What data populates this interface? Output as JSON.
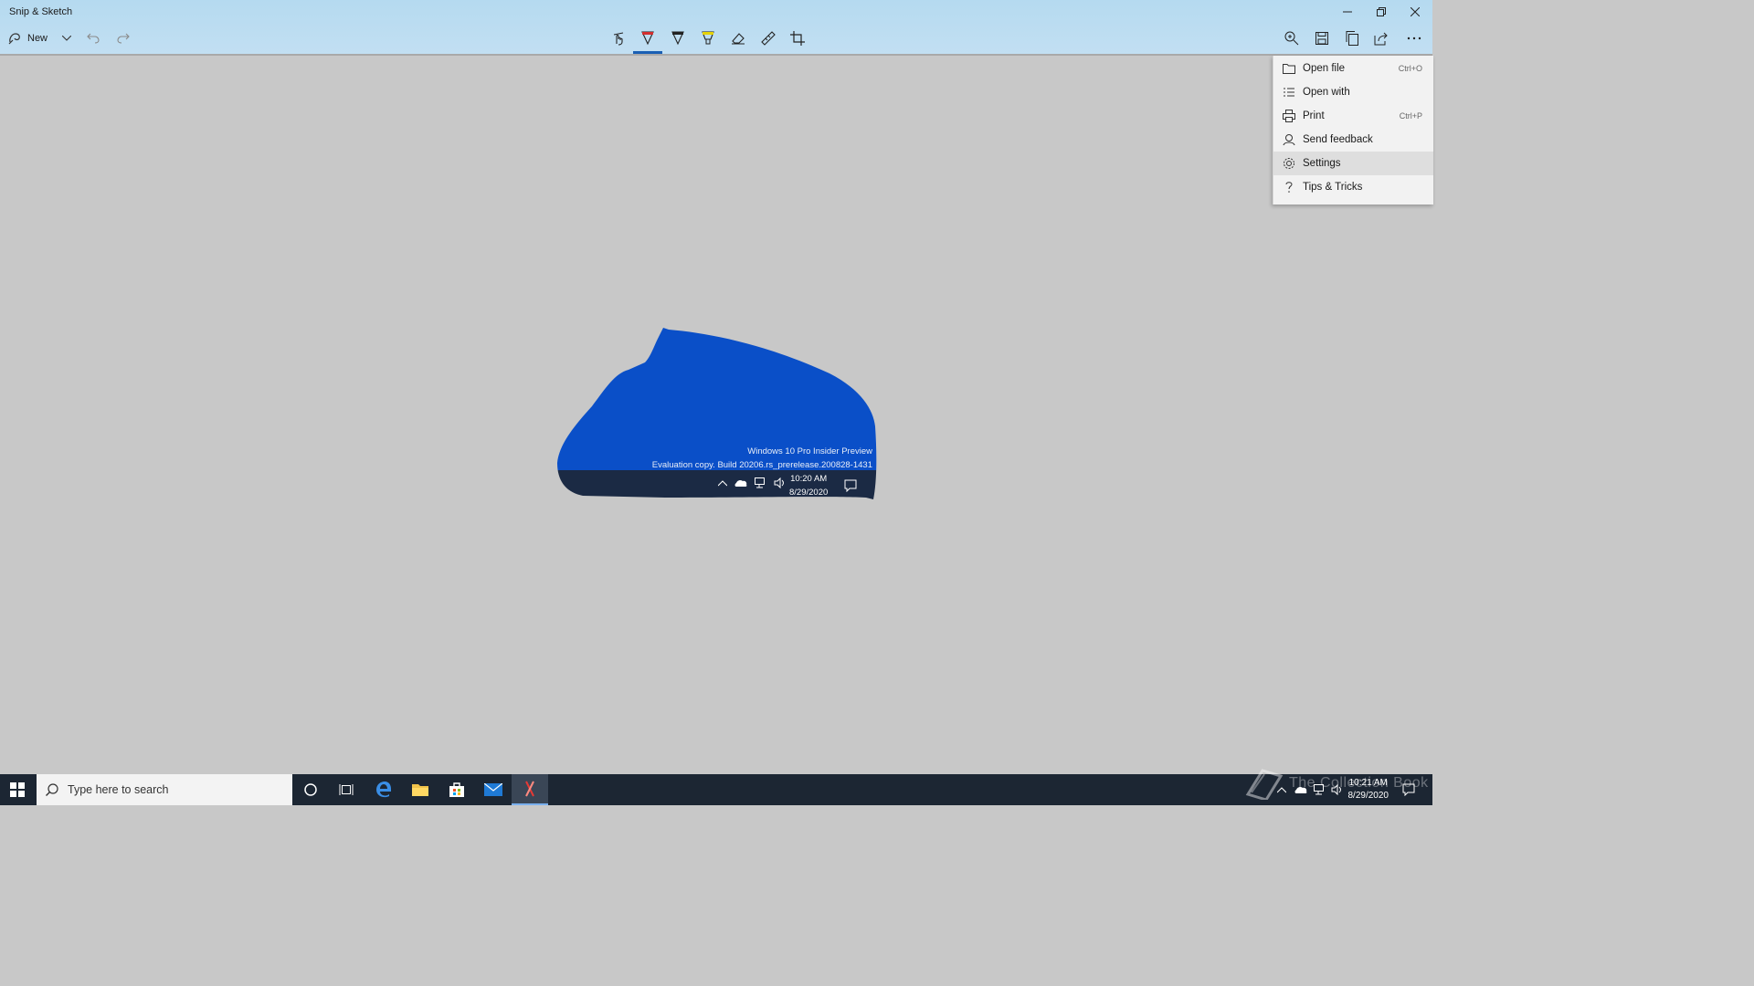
{
  "app": {
    "title": "Snip & Sketch"
  },
  "toolbar": {
    "new_label": "New",
    "tools": [
      "touch-writing",
      "ballpoint-pen",
      "pencil",
      "highlighter",
      "eraser",
      "ruler",
      "crop"
    ],
    "right": [
      "zoom",
      "save",
      "copy",
      "share",
      "more"
    ]
  },
  "menu": {
    "items": [
      {
        "label": "Open file",
        "shortcut": "Ctrl+O",
        "icon": "folder-icon"
      },
      {
        "label": "Open with",
        "shortcut": "",
        "icon": "list-icon"
      },
      {
        "label": "Print",
        "shortcut": "Ctrl+P",
        "icon": "printer-icon"
      },
      {
        "label": "Send feedback",
        "shortcut": "",
        "icon": "feedback-icon"
      },
      {
        "label": "Settings",
        "shortcut": "",
        "icon": "gear-icon"
      },
      {
        "label": "Tips & Tricks",
        "shortcut": "",
        "icon": "question-icon"
      }
    ],
    "selected_index": 4
  },
  "snip": {
    "watermark_line1": "Windows 10 Pro Insider Preview",
    "watermark_line2": "Evaluation copy. Build 20206.rs_prerelease.200828-1431",
    "time": "10:20 AM",
    "date": "8/29/2020"
  },
  "taskbar": {
    "search_placeholder": "Type here to search",
    "time": "10:21 AM",
    "date": "8/29/2020",
    "watermark": "The Collection Book"
  },
  "colors": {
    "accent": "#1a5fb4",
    "snip_blue": "#0a4fc8",
    "taskbar": "#1c2633"
  }
}
